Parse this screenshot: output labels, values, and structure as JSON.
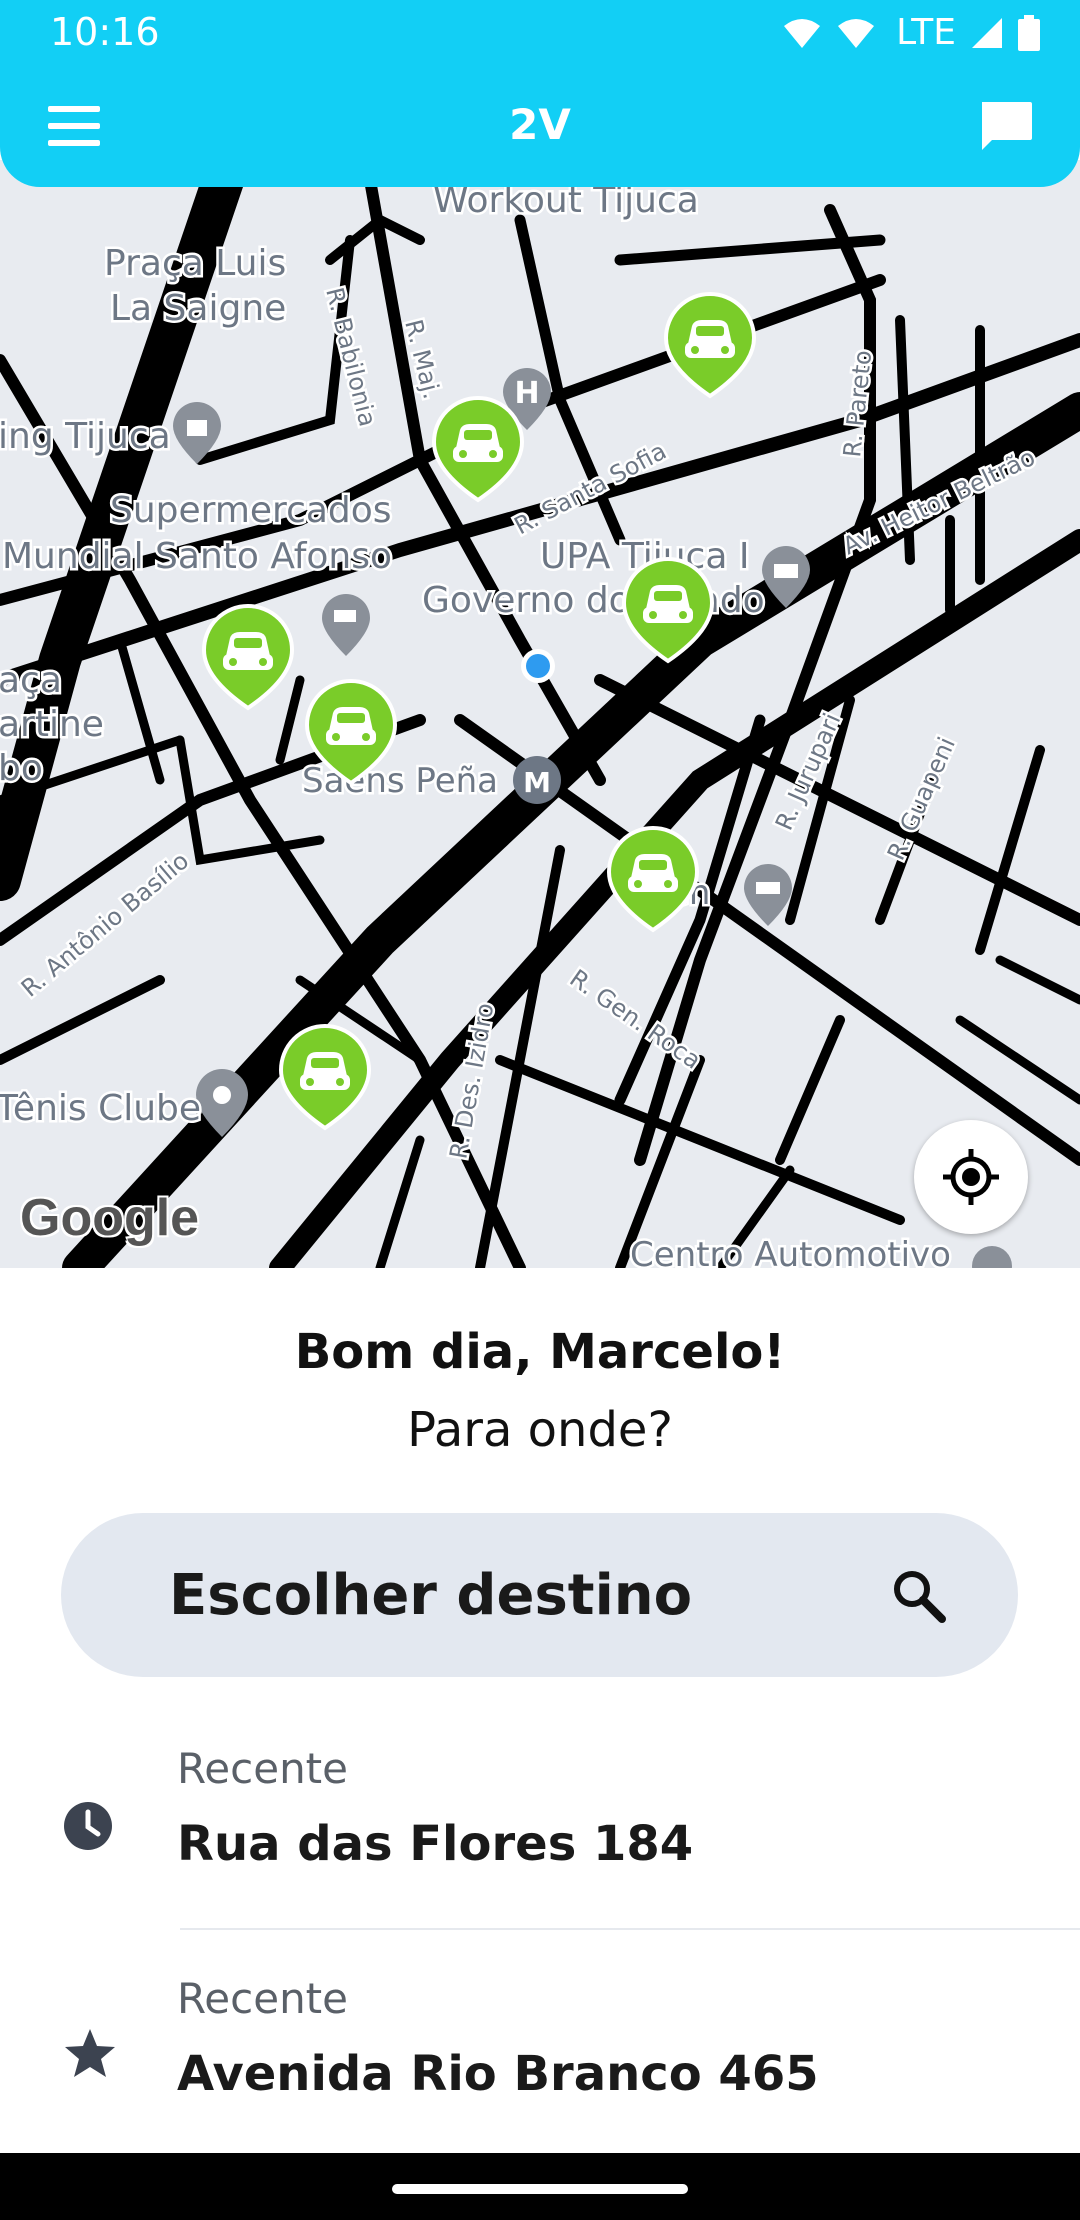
{
  "status": {
    "time": "10:16",
    "network": "LTE"
  },
  "header": {
    "title": "2V"
  },
  "map": {
    "labels": {
      "workout": "Workout Tijuca",
      "praca1": "Praça Luis",
      "praca2": "La Saigne",
      "tijuca": "ing Tijuca",
      "super1": "Supermercados",
      "super2": "Mundial Santo Afonso",
      "upa": "UPA Tijuca I",
      "governo": "Governo do Estado",
      "saens": "Saens Peña",
      "aca1": "aça",
      "aca2": "artine",
      "aca3": "bo",
      "tenis": "Tênis Clube",
      "centro": "Centro Automotivo",
      "babilonia": "R. Babilonia",
      "maj": "R. Maj.",
      "santafia": "R. Santa Sofia",
      "pareto": "R. Pareto",
      "heitor": "Av. Heitor Beltrão",
      "jurupari": "R. Jurupari",
      "guapeni": "R. Guapeni",
      "antonio": "R. Antônio Basílio",
      "genroca": "R. Gen. Roca",
      "izidro": "R. Des. Izidro",
      "en": "en"
    },
    "google_logo": "Google",
    "colors": {
      "car_pin": "#7ACC29",
      "water": "#E8EBF0",
      "road": "#000000",
      "accent": "#12CFF5"
    }
  },
  "sheet": {
    "greeting": "Bom dia, Marcelo!",
    "subtitle": "Para onde?",
    "search_placeholder": "Escolher destino",
    "recents": [
      {
        "label": "Recente",
        "address": "Rua das Flores 184",
        "icon": "clock-icon"
      },
      {
        "label": "Recente",
        "address": "Avenida Rio Branco 465",
        "icon": "star-icon"
      }
    ]
  }
}
